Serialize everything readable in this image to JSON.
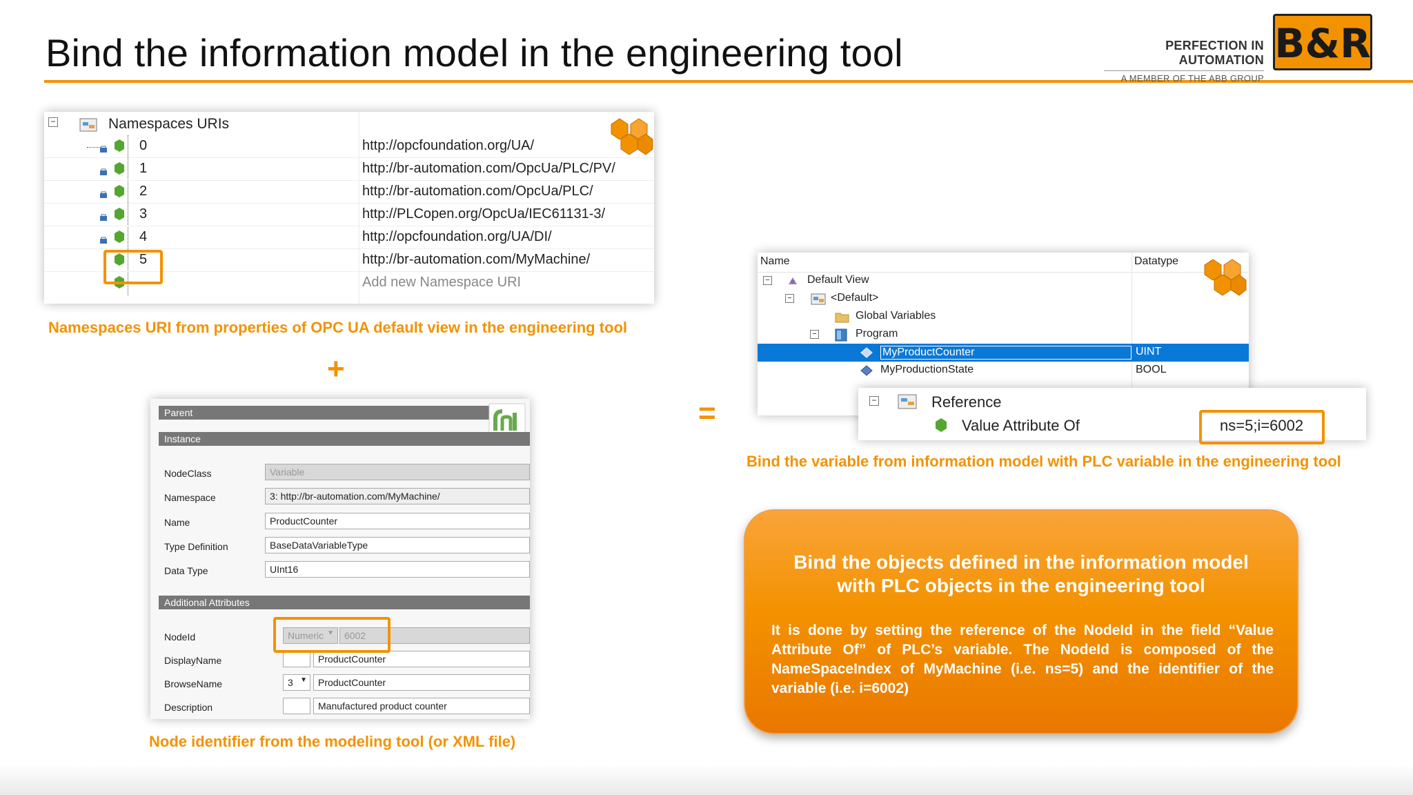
{
  "slide": {
    "title": "Bind the information model in the engineering tool",
    "slogan_main": "PERFECTION IN AUTOMATION",
    "slogan_sub": "A MEMBER OF THE ABB GROUP",
    "logo_text": "B&R",
    "accent_color": "#f39200"
  },
  "namespaces": {
    "root_label": "Namespaces URIs",
    "items": [
      {
        "index": "0",
        "uri": "http://opcfoundation.org/UA/"
      },
      {
        "index": "1",
        "uri": "http://br-automation.com/OpcUa/PLC/PV/"
      },
      {
        "index": "2",
        "uri": "http://br-automation.com/OpcUa/PLC/"
      },
      {
        "index": "3",
        "uri": "http://PLCopen.org/OpcUa/IEC61131-3/"
      },
      {
        "index": "4",
        "uri": "http://opcfoundation.org/UA/DI/"
      },
      {
        "index": "5",
        "uri": "http://br-automation.com/MyMachine/"
      }
    ],
    "add_placeholder": "Add new Namespace URI",
    "caption": "Namespaces URI from properties of OPC UA default view in the engineering tool"
  },
  "operators": {
    "plus": "+",
    "equals": "="
  },
  "model": {
    "parent_label": "Parent",
    "instance_label": "Instance",
    "fields": [
      {
        "label": "NodeClass",
        "value": "Variable"
      },
      {
        "label": "Namespace",
        "value": "3: http://br-automation.com/MyMachine/"
      },
      {
        "label": "Name",
        "value": "ProductCounter"
      },
      {
        "label": "Type Definition",
        "value": "BaseDataVariableType"
      },
      {
        "label": "Data Type",
        "value": "UInt16"
      }
    ],
    "additional_label": "Additional Attributes",
    "nodeid": {
      "label": "NodeId",
      "type": "Numeric",
      "value": "6002"
    },
    "displayname": {
      "label": "DisplayName",
      "locale": "",
      "value": "ProductCounter"
    },
    "browsename": {
      "label": "BrowseName",
      "ns": "3",
      "value": "ProductCounter"
    },
    "description": {
      "label": "Description",
      "locale": "",
      "value": "Manufactured product counter"
    },
    "caption": "Node identifier from the modeling tool (or XML file)"
  },
  "plc": {
    "col_name": "Name",
    "col_type": "Datatype",
    "rows": [
      {
        "label": "Default View",
        "type": ""
      },
      {
        "label": "<Default>",
        "type": ""
      },
      {
        "label": "Global Variables",
        "type": ""
      },
      {
        "label": "Program",
        "type": ""
      },
      {
        "label": "MyProductCounter",
        "type": "UINT"
      },
      {
        "label": "MyProductionState",
        "type": "BOOL"
      }
    ]
  },
  "reference": {
    "label": "Reference",
    "attr_label": "Value Attribute Of",
    "attr_value": "ns=5;i=6002",
    "caption": "Bind the variable from information model with PLC variable in the engineering tool"
  },
  "info": {
    "heading_line1": "Bind the objects defined in the information model",
    "heading_line2": "with PLC objects in the engineering tool",
    "body": "It is done by setting the reference of  the NodeId in the field “Value Attribute Of” of PLC’s variable. The NodeId is composed of the NameSpaceIndex of MyMachine  (i.e. ns=5) and the identifier of the variable (i.e. i=6002)"
  }
}
